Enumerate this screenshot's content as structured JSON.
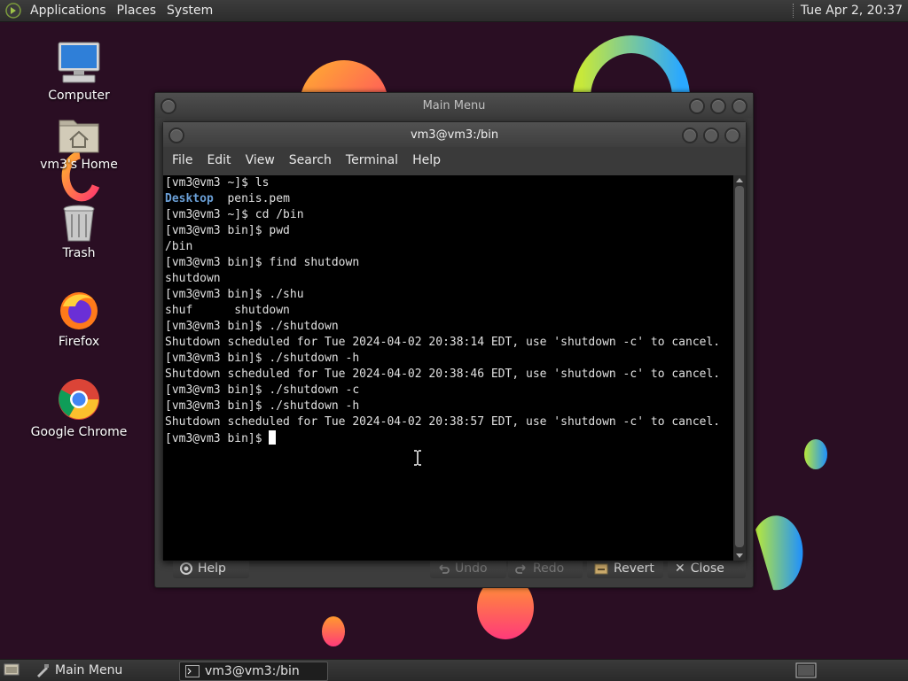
{
  "top_panel": {
    "menus": [
      "Applications",
      "Places",
      "System"
    ],
    "clock": "Tue Apr  2, 20:37"
  },
  "desktop_icons": [
    {
      "label": "Computer",
      "icon": "computer-icon"
    },
    {
      "label": "vm3's Home",
      "icon": "home-folder-icon"
    },
    {
      "label": "Trash",
      "icon": "trash-icon"
    },
    {
      "label": "Firefox",
      "icon": "firefox-icon"
    },
    {
      "label": "Google Chrome",
      "icon": "chrome-icon"
    }
  ],
  "back_window": {
    "title": "Main Menu",
    "buttons": {
      "help": "Help",
      "undo": "Undo",
      "redo": "Redo",
      "revert": "Revert",
      "close": "Close"
    }
  },
  "terminal": {
    "title": "vm3@vm3:/bin",
    "menus": [
      "File",
      "Edit",
      "View",
      "Search",
      "Terminal",
      "Help"
    ],
    "lines": [
      "[vm3@vm3 ~]$ ls",
      "",
      "[vm3@vm3 ~]$ cd /bin",
      "[vm3@vm3 bin]$ pwd",
      "/bin",
      "[vm3@vm3 bin]$ find shutdown",
      "shutdown",
      "[vm3@vm3 bin]$ ./shu",
      "shuf      shutdown",
      "[vm3@vm3 bin]$ ./shutdown",
      "Shutdown scheduled for Tue 2024-04-02 20:38:14 EDT, use 'shutdown -c' to cancel.",
      "[vm3@vm3 bin]$ ./shutdown -h",
      "Shutdown scheduled for Tue 2024-04-02 20:38:46 EDT, use 'shutdown -c' to cancel.",
      "[vm3@vm3 bin]$ ./shutdown -c",
      "[vm3@vm3 bin]$ ./shutdown -h",
      "Shutdown scheduled for Tue 2024-04-02 20:38:57 EDT, use 'shutdown -c' to cancel.",
      "[vm3@vm3 bin]$ "
    ],
    "ls_output": {
      "dir": "Desktop",
      "file": "  penis.pem"
    }
  },
  "taskbar": {
    "tasks": [
      "Main Menu",
      "vm3@vm3:/bin"
    ]
  }
}
